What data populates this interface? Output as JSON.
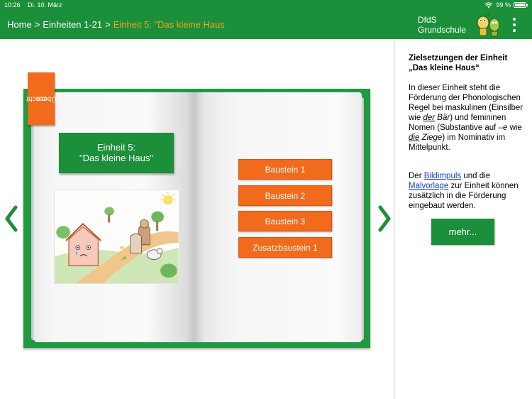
{
  "status_bar": {
    "time": "10:26",
    "date": "Di. 10. März",
    "battery": "99 %",
    "battery_level": 0.99
  },
  "nav": {
    "crumbs": [
      {
        "label": "Home"
      },
      {
        "label": "Einheiten 1-21"
      },
      {
        "label": "Einheit 5: \"Das kleine Haus"
      }
    ],
    "separator": ">",
    "brand_line1": "DfdS",
    "brand_line2": "Grundschule"
  },
  "book": {
    "overview_tab_line1": "zur",
    "overview_tab_line2": "Übersicht",
    "unit_title_line1": "Einheit 5:",
    "unit_title_line2": "\"Das kleine Haus\"",
    "modules": [
      {
        "label": "Baustein 1"
      },
      {
        "label": "Baustein 2"
      },
      {
        "label": "Baustein 3"
      },
      {
        "label": "Zusatzbaustein 1"
      }
    ]
  },
  "sidebar": {
    "title_line1": "Zielsetzungen der Einheit",
    "title_line2": "„Das kleine Haus“",
    "para1_a": "In dieser Einheit steht die Förderung der Phonologischen Regel bei maskulinen (Einsilber wie ",
    "para1_der": "der",
    "para1_baer": "Bär",
    "para1_b": ") und femininen Nomen (Substantive auf ",
    "para1_e": "–e",
    "para1_c": " wie ",
    "para1_die": "die",
    "para1_ziege": "Ziege",
    "para1_d": ") im Nominativ im Mittelpunkt.",
    "para2_a": "Der ",
    "link_bildimpuls": "Bildimpuls",
    "para2_b": " und die ",
    "link_malvorlage": "Malvorlage",
    "para2_c": " zur Einheit können zusätzlich in die Förderung eingebaut werden.",
    "more_button": "mehr..."
  },
  "colors": {
    "green": "#1b8f3a",
    "orange": "#f26a1b",
    "crumb_current": "#f6a21b",
    "link": "#1a3fd3"
  }
}
